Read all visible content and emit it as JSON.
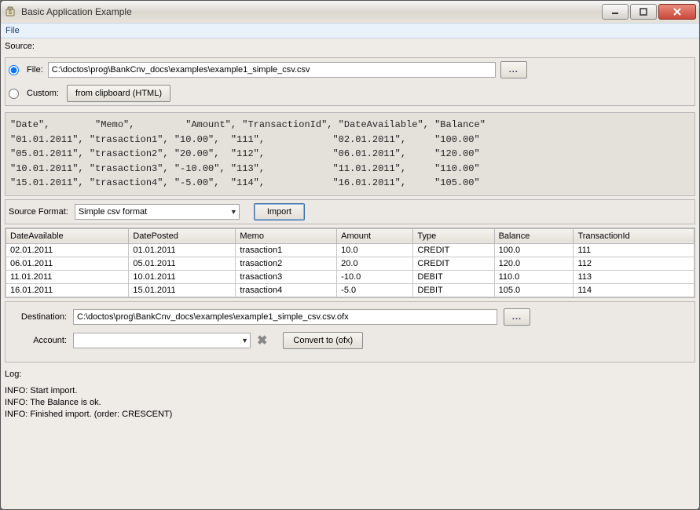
{
  "window": {
    "title": "Basic Application Example"
  },
  "menu": {
    "file": "File"
  },
  "source": {
    "label": "Source:",
    "file_label": "File:",
    "file_path": "C:\\doctos\\prog\\BankCnv_docs\\examples\\example1_simple_csv.csv",
    "browse": "...",
    "custom_label": "Custom:",
    "clipboard_btn": "from clipboard (HTML)",
    "preview": "\"Date\",        \"Memo\",         \"Amount\", \"TransactionId\", \"DateAvailable\", \"Balance\"\n\"01.01.2011\", \"trasaction1\", \"10.00\",  \"111\",            \"02.01.2011\",     \"100.00\"\n\"05.01.2011\", \"trasaction2\", \"20.00\",  \"112\",            \"06.01.2011\",     \"120.00\"\n\"10.01.2011\", \"trasaction3\", \"-10.00\", \"113\",            \"11.01.2011\",     \"110.00\"\n\"15.01.2011\", \"trasaction4\", \"-5.00\",  \"114\",            \"16.01.2011\",     \"105.00\""
  },
  "format": {
    "label": "Source Format:",
    "value": "Simple csv format",
    "import_btn": "Import"
  },
  "table": {
    "headers": [
      "DateAvailable",
      "DatePosted",
      "Memo",
      "Amount",
      "Type",
      "Balance",
      "TransactionId"
    ],
    "rows": [
      [
        "02.01.2011",
        "01.01.2011",
        "trasaction1",
        "10.0",
        "CREDIT",
        "100.0",
        "111"
      ],
      [
        "06.01.2011",
        "05.01.2011",
        "trasaction2",
        "20.0",
        "CREDIT",
        "120.0",
        "112"
      ],
      [
        "11.01.2011",
        "10.01.2011",
        "trasaction3",
        "-10.0",
        "DEBIT",
        "110.0",
        "113"
      ],
      [
        "16.01.2011",
        "15.01.2011",
        "trasaction4",
        "-5.0",
        "DEBIT",
        "105.0",
        "114"
      ]
    ]
  },
  "dest": {
    "label": "Destination:",
    "path": "C:\\doctos\\prog\\BankCnv_docs\\examples\\example1_simple_csv.csv.ofx",
    "browse": "...",
    "account_label": "Account:",
    "account_value": "",
    "convert_btn": "Convert to (ofx)"
  },
  "log": {
    "label": "Log:",
    "lines": [
      "INFO: Start import.",
      "INFO: The Balance is ok.",
      "INFO: Finished import. (order: CRESCENT)"
    ]
  }
}
